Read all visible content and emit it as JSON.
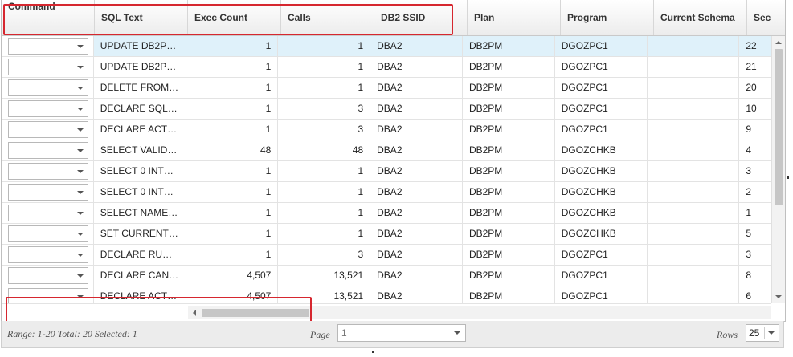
{
  "columns": [
    "Command",
    "SQL Text",
    "Exec Count",
    "Calls",
    "DB2 SSID",
    "Plan",
    "Program",
    "Current Schema",
    "Sec"
  ],
  "rows": [
    {
      "sql": "UPDATE DB2P…",
      "exec": "1",
      "calls": "1",
      "ssid": "DBA2",
      "plan": "DB2PM",
      "program": "DGOZPC1",
      "schema": "",
      "sec": "22"
    },
    {
      "sql": "UPDATE DB2P…",
      "exec": "1",
      "calls": "1",
      "ssid": "DBA2",
      "plan": "DB2PM",
      "program": "DGOZPC1",
      "schema": "",
      "sec": "21"
    },
    {
      "sql": "DELETE FROM…",
      "exec": "1",
      "calls": "1",
      "ssid": "DBA2",
      "plan": "DB2PM",
      "program": "DGOZPC1",
      "schema": "",
      "sec": "20"
    },
    {
      "sql": "DECLARE SQL…",
      "exec": "1",
      "calls": "3",
      "ssid": "DBA2",
      "plan": "DB2PM",
      "program": "DGOZPC1",
      "schema": "",
      "sec": "10"
    },
    {
      "sql": "DECLARE ACT…",
      "exec": "1",
      "calls": "3",
      "ssid": "DBA2",
      "plan": "DB2PM",
      "program": "DGOZPC1",
      "schema": "",
      "sec": "9"
    },
    {
      "sql": "SELECT VALID …",
      "exec": "48",
      "calls": "48",
      "ssid": "DBA2",
      "plan": "DB2PM",
      "program": "DGOZCHKB",
      "schema": "",
      "sec": "4"
    },
    {
      "sql": "SELECT 0 INT…",
      "exec": "1",
      "calls": "1",
      "ssid": "DBA2",
      "plan": "DB2PM",
      "program": "DGOZCHKB",
      "schema": "",
      "sec": "3"
    },
    {
      "sql": "SELECT 0 INT…",
      "exec": "1",
      "calls": "1",
      "ssid": "DBA2",
      "plan": "DB2PM",
      "program": "DGOZCHKB",
      "schema": "",
      "sec": "2"
    },
    {
      "sql": "SELECT NAME…",
      "exec": "1",
      "calls": "1",
      "ssid": "DBA2",
      "plan": "DB2PM",
      "program": "DGOZCHKB",
      "schema": "",
      "sec": "1"
    },
    {
      "sql": "SET CURRENT…",
      "exec": "1",
      "calls": "1",
      "ssid": "DBA2",
      "plan": "DB2PM",
      "program": "DGOZCHKB",
      "schema": "",
      "sec": "5"
    },
    {
      "sql": "DECLARE RUN…",
      "exec": "1",
      "calls": "3",
      "ssid": "DBA2",
      "plan": "DB2PM",
      "program": "DGOZPC1",
      "schema": "",
      "sec": "3"
    },
    {
      "sql": "DECLARE CAN…",
      "exec": "4,507",
      "calls": "13,521",
      "ssid": "DBA2",
      "plan": "DB2PM",
      "program": "DGOZPC1",
      "schema": "",
      "sec": "8"
    },
    {
      "sql": "DECLARE ACT…",
      "exec": "4,507",
      "calls": "13,521",
      "ssid": "DBA2",
      "plan": "DB2PM",
      "program": "DGOZPC1",
      "schema": "",
      "sec": "6"
    }
  ],
  "selected_row": 0,
  "footer": {
    "range_text": "Range: 1-20 Total: 20 Selected: 1",
    "page_label": "Page",
    "page_value": "1",
    "rows_label": "Rows",
    "rows_value": "25"
  },
  "colors": {
    "highlight": "#d6272f",
    "selected_row": "#dff1fa"
  },
  "icons": [
    "chevron-down-icon",
    "scroll-up-icon",
    "scroll-down-icon",
    "scroll-left-icon"
  ]
}
